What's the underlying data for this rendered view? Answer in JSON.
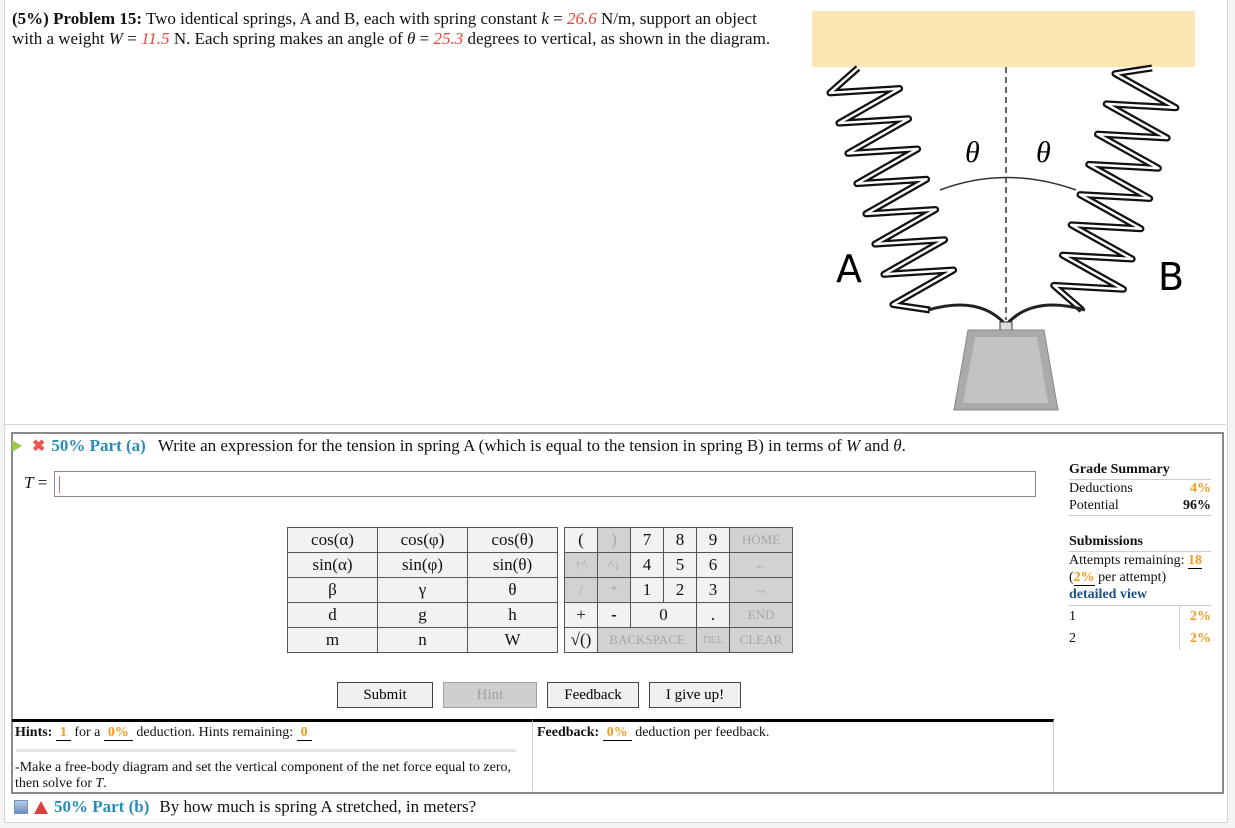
{
  "problem": {
    "weight_pct": "(5%)",
    "label": "Problem 15:",
    "text_1": "Two identical springs, A and B, each with spring constant ",
    "k_sym": "k",
    "eq": " = ",
    "k_val": "26.6",
    "k_unit": " N/m, support an object with a weight ",
    "w_sym": "W",
    "w_val": "11.5",
    "w_unit": " N. Each spring makes an angle of ",
    "theta_sym": "θ",
    "theta_val": "25.3",
    "text_end": " degrees to vertical, as shown in the diagram."
  },
  "diagram": {
    "label_a": "A",
    "label_b": "B",
    "angle_left": "θ",
    "angle_right": "θ",
    "ceiling_color": "#fde5b4"
  },
  "part_a": {
    "pct": "50% Part (a)",
    "question_1": "Write an expression for the tension in spring A (which is equal to the tension in spring B) in terms of ",
    "w_sym": "W",
    "and": " and ",
    "theta_sym": "θ",
    "period": ".",
    "answer_label": "T =",
    "answer_value": ""
  },
  "keypad": {
    "functions": [
      [
        "cos(α)",
        "cos(φ)",
        "cos(θ)"
      ],
      [
        "sin(α)",
        "sin(φ)",
        "sin(θ)"
      ],
      [
        "β",
        "γ",
        "θ"
      ],
      [
        "d",
        "g",
        "h"
      ],
      [
        "m",
        "n",
        "W"
      ]
    ],
    "open_paren": "(",
    "close_paren": ")",
    "up": "↑^",
    "down": "^↓",
    "divide": "/",
    "multiply": "*",
    "plus": "+",
    "minus": "-",
    "sqrt": "√()",
    "digits": [
      "7",
      "8",
      "9",
      "4",
      "5",
      "6",
      "1",
      "2",
      "3",
      "0",
      "."
    ],
    "home": "HOME",
    "left": "←",
    "right": "→",
    "end": "END",
    "backspace": "BACKSPACE",
    "del": "DEL",
    "clear": "CLEAR"
  },
  "buttons": {
    "submit": "Submit",
    "hint": "Hint",
    "feedback": "Feedback",
    "give_up": "I give up!"
  },
  "hints": {
    "label": "Hints:",
    "count": "1",
    "for_a": " for a ",
    "pct": "0%",
    "deduction": " deduction. Hints remaining: ",
    "remaining": "0",
    "text": "-Make a free-body diagram and set the vertical component of the net force equal to zero, then solve for ",
    "t_sym": "T",
    "period": "."
  },
  "feedback": {
    "label": "Feedback:",
    "pct": "0%",
    "text": " deduction per feedback."
  },
  "grade_summary": {
    "title": "Grade Summary",
    "deductions_label": "Deductions",
    "deductions_value": "4%",
    "potential_label": "Potential",
    "potential_value": "96%",
    "submissions_title": "Submissions",
    "attempts_label": "Attempts remaining: ",
    "attempts_value": "18",
    "per_attempt_open": "(",
    "per_attempt_value": "2%",
    "per_attempt_text": " per attempt)",
    "detailed_view": "detailed view",
    "attempts": [
      {
        "n": "1",
        "pct": "2%"
      },
      {
        "n": "2",
        "pct": "2%"
      }
    ]
  },
  "part_b": {
    "pct": "50% Part (b)",
    "question": "By how much is spring A stretched, in meters?"
  }
}
